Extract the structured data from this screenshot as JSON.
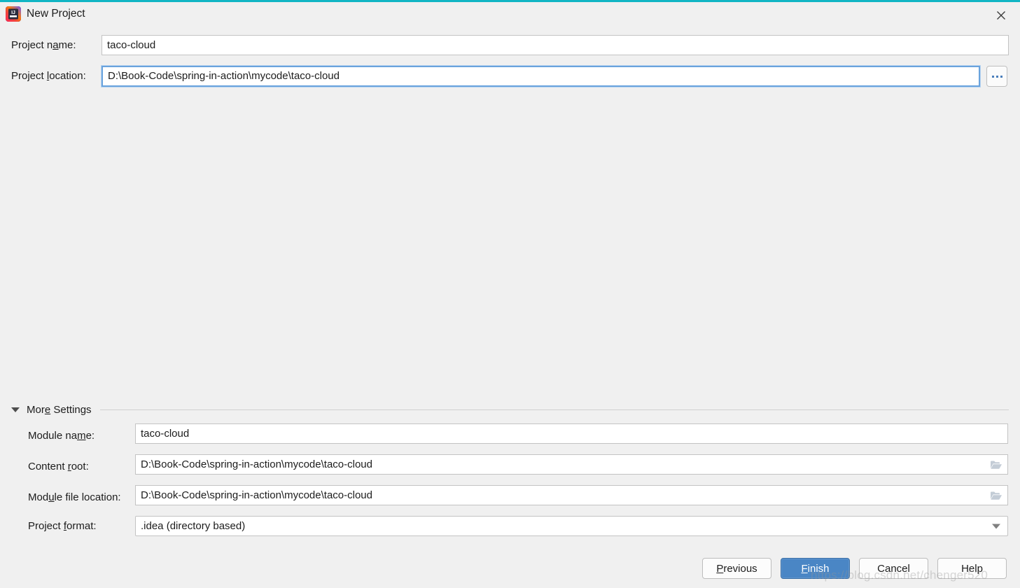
{
  "window": {
    "title": "New Project",
    "accent_color": "#11b5c4",
    "background_color": "#f0f0f0",
    "app_icon": "intellij-idea-icon",
    "close_icon": "close-icon"
  },
  "form": {
    "project_name": {
      "label_pre": "Project n",
      "label_mnemonic": "a",
      "label_post": "me:",
      "value": "taco-cloud",
      "focused": false
    },
    "project_location": {
      "label_pre": "Project ",
      "label_mnemonic": "l",
      "label_post": "ocation:",
      "value": "D:\\Book-Code\\spring-in-action\\mycode\\taco-cloud",
      "focused": true
    },
    "browse_button": {
      "label": "...",
      "icon": "ellipsis-icon"
    }
  },
  "more_settings": {
    "label_pre": "Mor",
    "label_mnemonic": "e",
    "label_post": " Settings",
    "expanded": true,
    "toggle_icon": "chevron-down-icon",
    "fields": {
      "module_name": {
        "label_pre": "Module na",
        "label_mnemonic": "m",
        "label_post": "e:",
        "value": "taco-cloud",
        "has_browse_icon": false
      },
      "content_root": {
        "label_pre": "Content ",
        "label_mnemonic": "r",
        "label_post": "oot:",
        "value": "D:\\Book-Code\\spring-in-action\\mycode\\taco-cloud",
        "has_browse_icon": true,
        "browse_icon": "folder-open-icon"
      },
      "module_file_location": {
        "label_pre": "Mod",
        "label_mnemonic": "u",
        "label_post": "le file location:",
        "value": "D:\\Book-Code\\spring-in-action\\mycode\\taco-cloud",
        "has_browse_icon": true,
        "browse_icon": "folder-open-icon"
      },
      "project_format": {
        "label_pre": "Project ",
        "label_mnemonic": "f",
        "label_post": "ormat:",
        "value": ".idea (directory based)",
        "dropdown_icon": "chevron-down-icon"
      }
    }
  },
  "buttons": {
    "previous": {
      "pre": "",
      "mnemonic": "P",
      "post": "revious"
    },
    "finish": {
      "pre": "",
      "mnemonic": "F",
      "post": "inish",
      "primary": true,
      "color": "#4a86c5"
    },
    "cancel": {
      "pre": "Cancel",
      "mnemonic": "",
      "post": ""
    },
    "help": {
      "pre": "Help",
      "mnemonic": "",
      "post": ""
    }
  },
  "watermark": {
    "text": "https://blog.csdn.net/chenger520"
  }
}
